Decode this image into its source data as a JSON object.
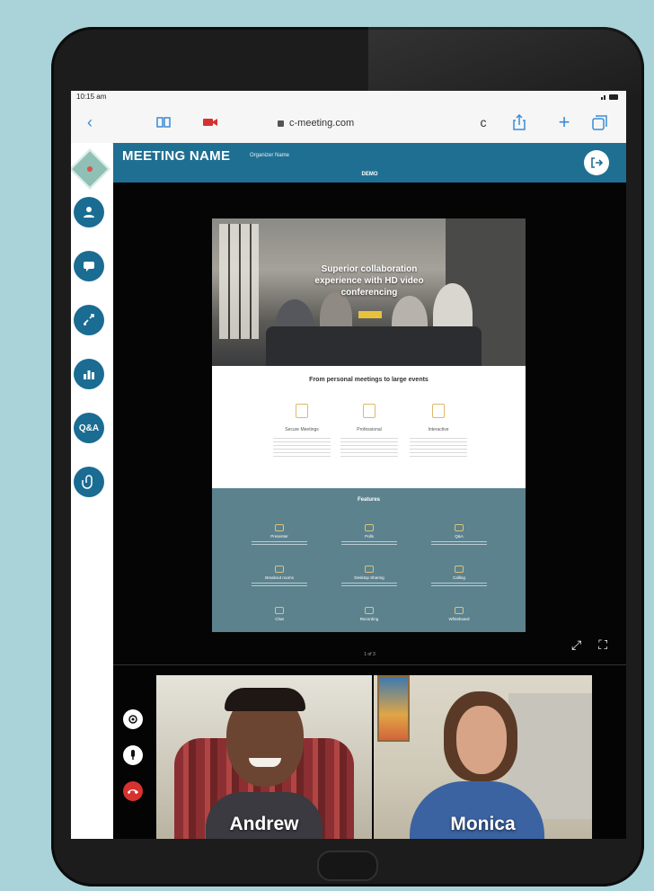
{
  "status": {
    "time": "10:15 am"
  },
  "browser": {
    "url": "c-meeting.com",
    "icons": [
      "back-icon",
      "bookmarks-icon",
      "camera-icon",
      "lock-icon",
      "reload-icon",
      "share-icon",
      "new-tab-icon",
      "tabs-icon"
    ]
  },
  "meeting": {
    "title": "MEETING NAME",
    "organizer": "Organizer Name",
    "status": "DEMO",
    "exit_icon": "exit-icon"
  },
  "toolbar": {
    "tools": [
      {
        "name": "participants",
        "icon": "user-icon",
        "label": ""
      },
      {
        "name": "chat",
        "icon": "chat-icon",
        "label": ""
      },
      {
        "name": "share",
        "icon": "share-screen-icon",
        "label": ""
      },
      {
        "name": "poll",
        "icon": "chart-icon",
        "label": ""
      },
      {
        "name": "qa",
        "icon": "qa-icon",
        "label": "Q&A"
      },
      {
        "name": "handout",
        "icon": "attach-icon",
        "label": ""
      }
    ]
  },
  "shared_page": {
    "hero_text": "Superior collaboration experience with HD video conferencing",
    "tagline": "From personal meetings to large events",
    "features": [
      "Secure Meetings",
      "Professional",
      "Interactive"
    ],
    "panel_title": "Features",
    "panel_items": [
      "Presenter",
      "Polls",
      "Q&A",
      "Breakout rooms",
      "Desktop Sharing",
      "Calling",
      "Chat",
      "Recording",
      "Whiteboard"
    ],
    "page_indicator": "1 of 3"
  },
  "participants": [
    {
      "name": "Andrew"
    },
    {
      "name": "Monica"
    }
  ],
  "colors": {
    "accent": "#1f6f93",
    "end_call": "#d6322f",
    "background": "#a9d3d8"
  }
}
